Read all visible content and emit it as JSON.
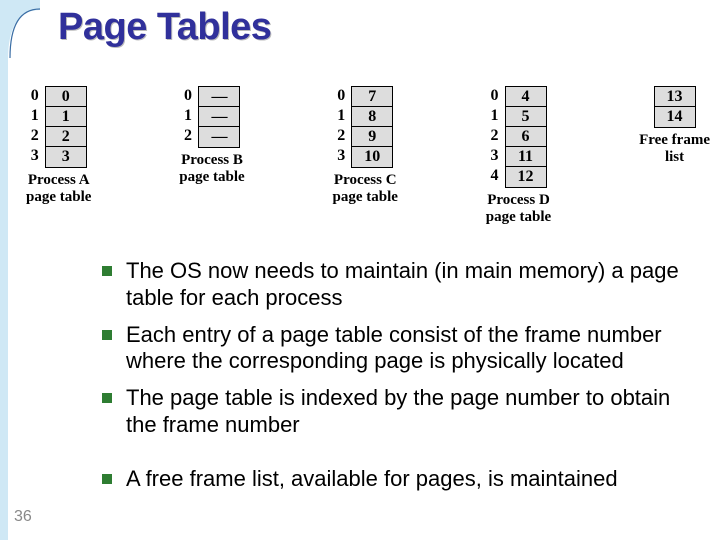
{
  "title": "Page Tables",
  "slide_number": "36",
  "tables": [
    {
      "indices": [
        "0",
        "1",
        "2",
        "3"
      ],
      "frames": [
        "0",
        "1",
        "2",
        "3"
      ],
      "caption_l1": "Process A",
      "caption_l2": "page table"
    },
    {
      "indices": [
        "0",
        "1",
        "2"
      ],
      "frames": [
        "—",
        "—",
        "—"
      ],
      "caption_l1": "Process B",
      "caption_l2": "page table"
    },
    {
      "indices": [
        "0",
        "1",
        "2",
        "3"
      ],
      "frames": [
        "7",
        "8",
        "9",
        "10"
      ],
      "caption_l1": "Process C",
      "caption_l2": "page table"
    },
    {
      "indices": [
        "0",
        "1",
        "2",
        "3",
        "4"
      ],
      "frames": [
        "4",
        "5",
        "6",
        "11",
        "12"
      ],
      "caption_l1": "Process D",
      "caption_l2": "page table"
    },
    {
      "indices": [],
      "frames": [
        "13",
        "14"
      ],
      "caption_l1": "Free frame",
      "caption_l2": "list"
    }
  ],
  "bullets_group1": [
    "The OS now needs to maintain (in main memory) a page table for each process",
    "Each entry of a page table consist of the frame number where the corresponding page is physically located",
    "The page table is indexed by the page number to obtain the frame number"
  ],
  "bullets_group2": [
    "A free frame list, available for pages, is maintained"
  ]
}
